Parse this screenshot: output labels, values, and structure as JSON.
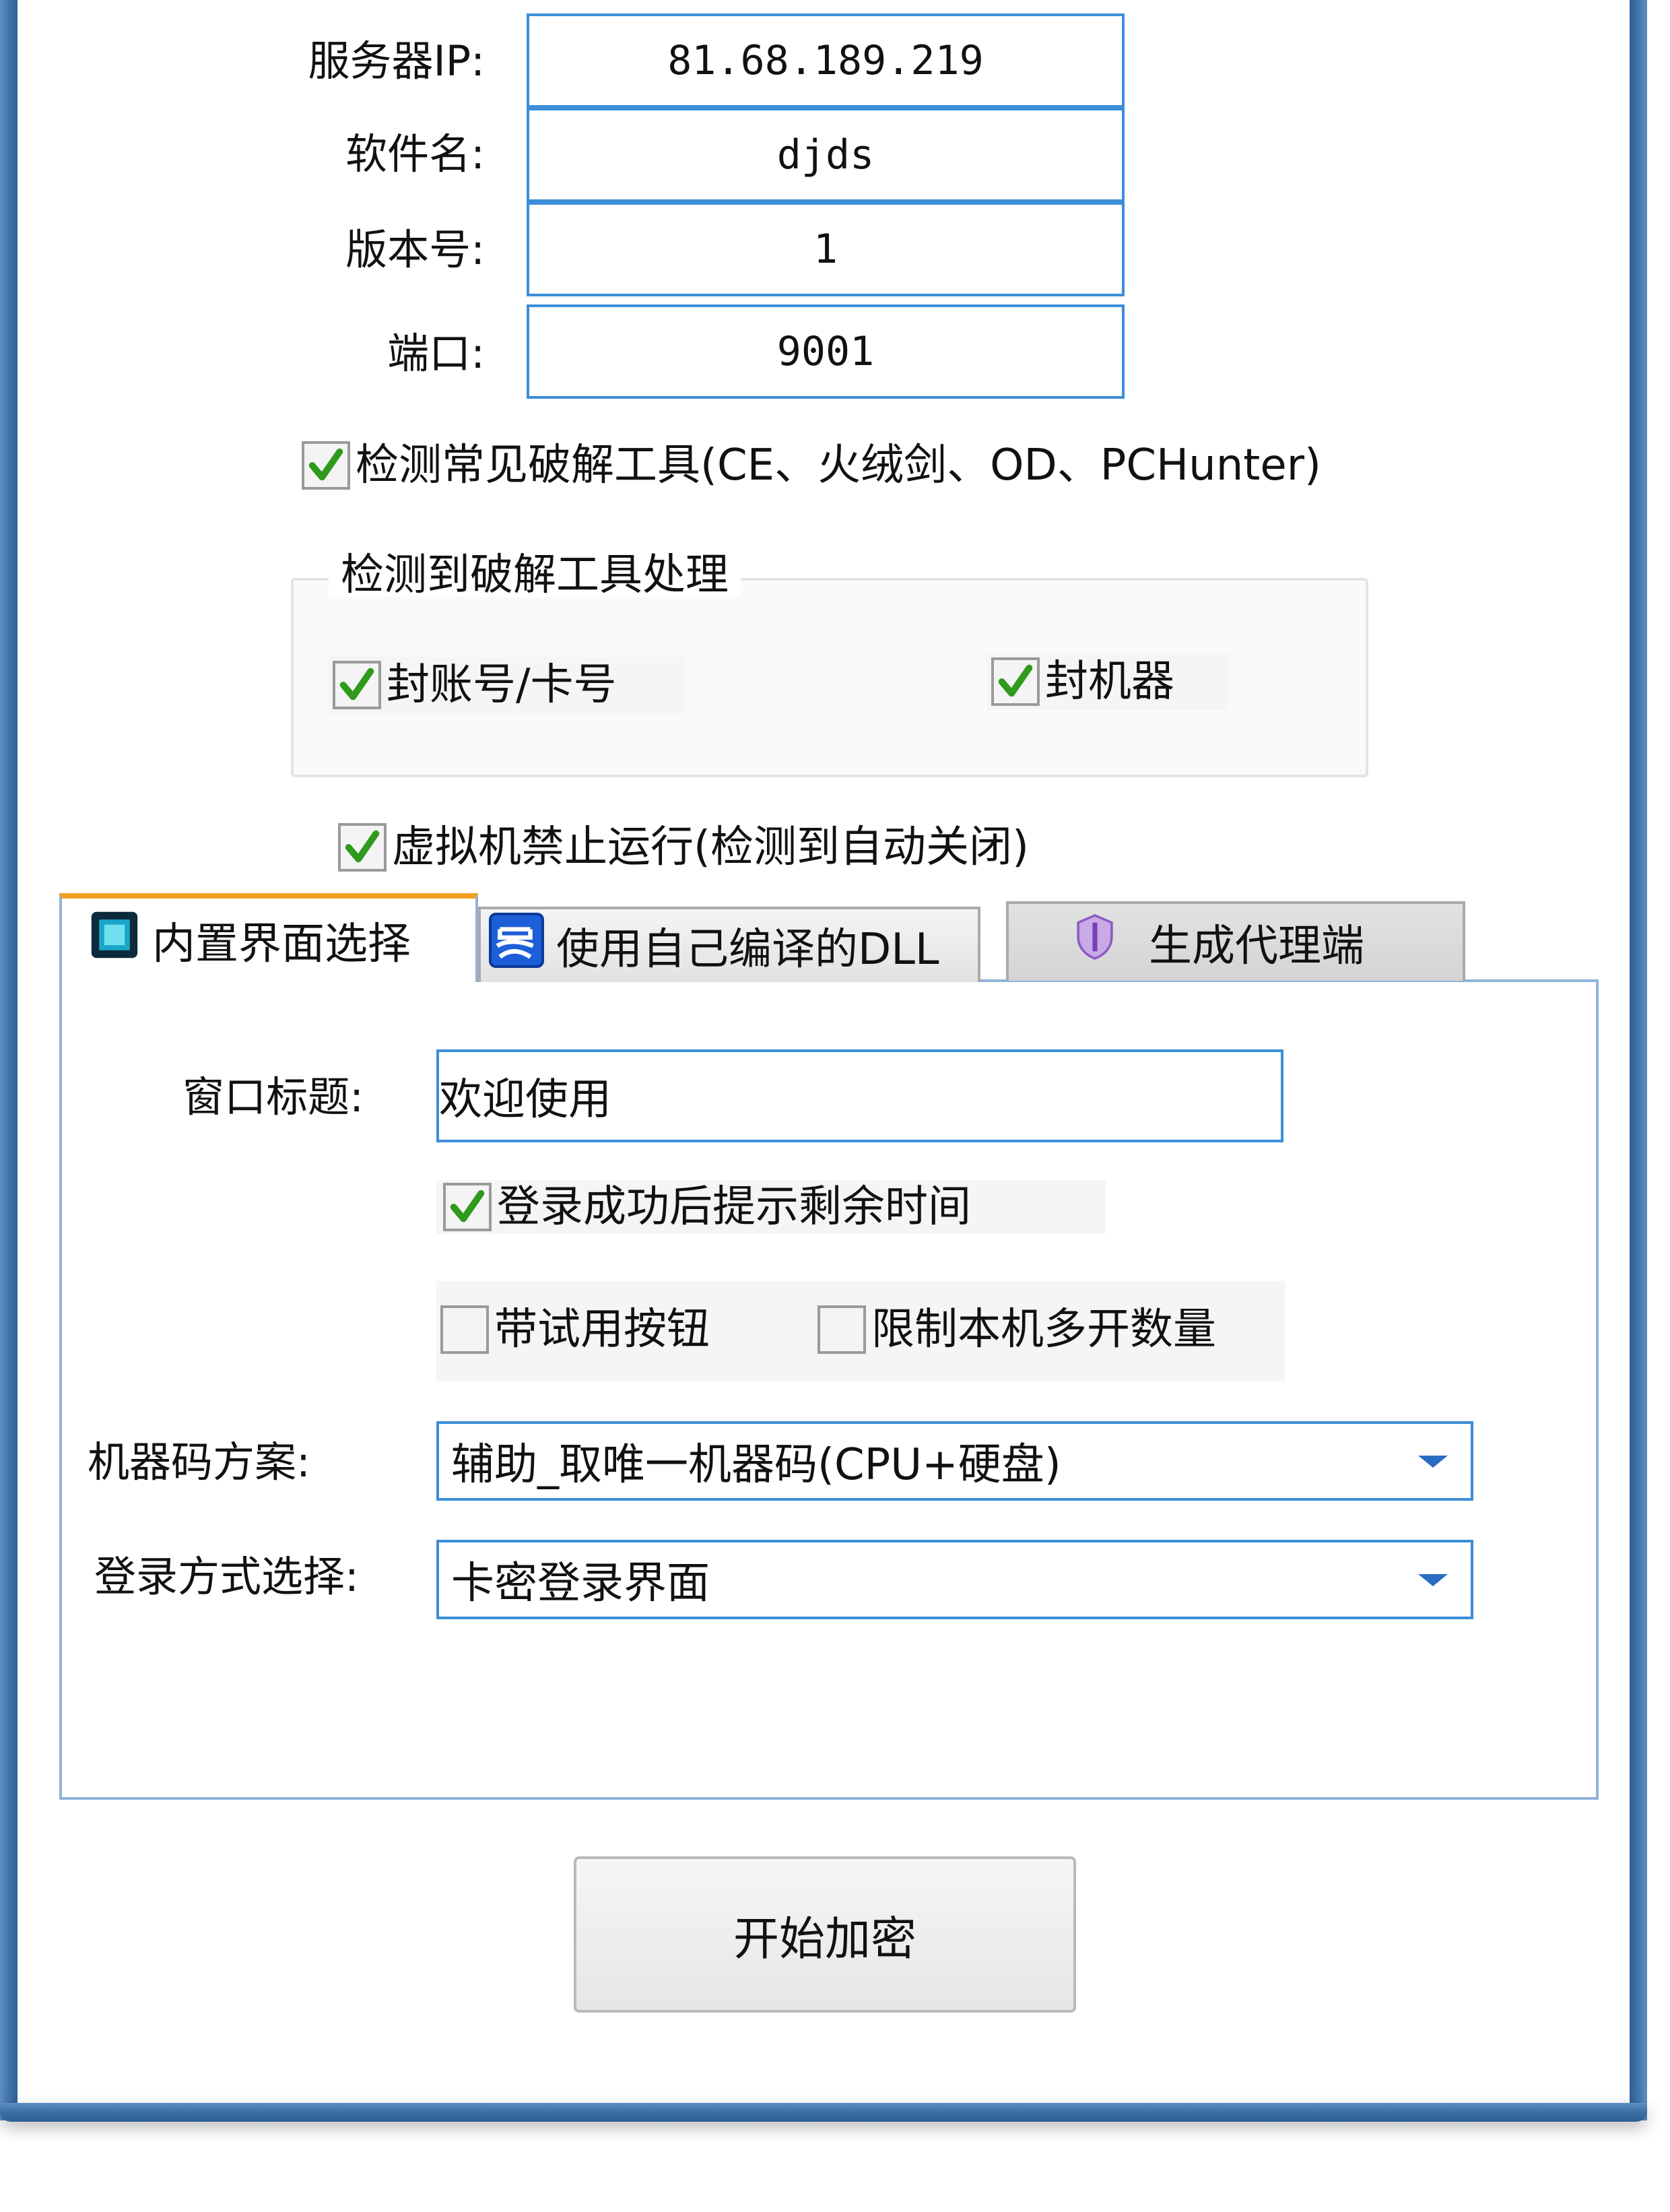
{
  "server": {
    "ip_label": "服务器IP:",
    "ip_value": "81.68.189.219",
    "name_label": "软件名:",
    "name_value": "djds",
    "version_label": "版本号:",
    "version_value": "1",
    "port_label": "端口:",
    "port_value": "9001"
  },
  "detect_tools": {
    "label": "检测常见破解工具(CE、火绒剑、OD、PCHunter)",
    "checked": true
  },
  "detect_group": {
    "title": "检测到破解工具处理",
    "ban_account": {
      "label": "封账号/卡号",
      "checked": true
    },
    "ban_machine": {
      "label": "封机器",
      "checked": true
    }
  },
  "vm_block": {
    "label": "虚拟机禁止运行(检测到自动关闭)",
    "checked": true
  },
  "tabs": [
    {
      "label": "内置界面选择",
      "icon": "cube-icon",
      "active": true
    },
    {
      "label": "使用自己编译的DLL",
      "icon": "easy-language-icon",
      "active": false
    },
    {
      "label": "生成代理端",
      "icon": "shield-icon",
      "active": false
    }
  ],
  "tab_panel": {
    "title_label": "窗口标题:",
    "title_value": "欢迎使用",
    "show_remaining": {
      "label": "登录成功后提示剩余时间",
      "checked": true
    },
    "trial_button": {
      "label": "带试用按钮",
      "checked": false
    },
    "limit_instances": {
      "label": "限制本机多开数量",
      "checked": false
    },
    "machine_code_label": "机器码方案:",
    "machine_code_value": "辅助_取唯一机器码(CPU+硬盘)",
    "login_mode_label": "登录方式选择:",
    "login_mode_value": "卡密登录界面"
  },
  "actions": {
    "start_label": "开始加密"
  },
  "colors": {
    "frame": "#3d6fa6",
    "field_border": "#3c8ed8",
    "check": "#2f9a1c",
    "active_tab_accent": "#f0a020"
  }
}
